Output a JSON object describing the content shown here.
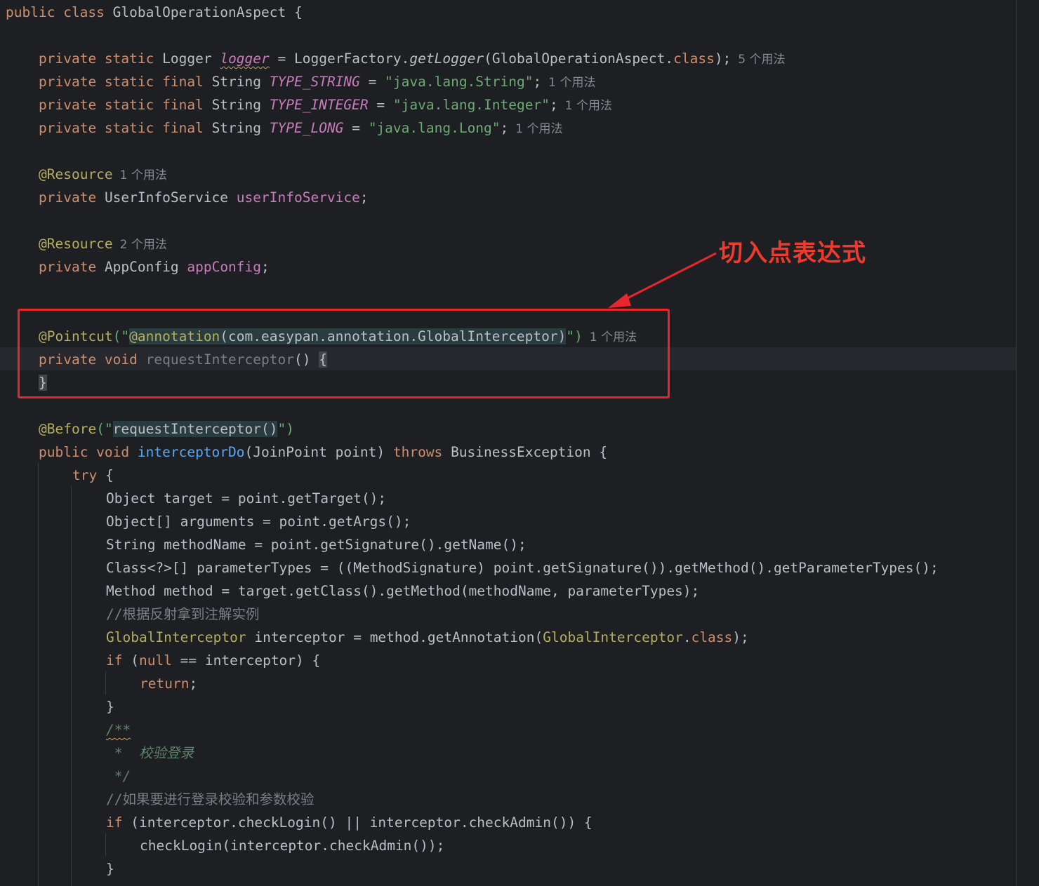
{
  "editor": {
    "class_decl": {
      "keyword1": "public",
      "keyword2": "class",
      "name": "GlobalOperationAspect",
      "brace": "{"
    },
    "logger_line": {
      "mods": "private static",
      "type": "Logger",
      "name": "logger",
      "eq": "=",
      "factory": "LoggerFactory.",
      "method": "getLogger",
      "arg": "(GlobalOperationAspect.",
      "cls": "class",
      "end": ");",
      "hint": "5 个用法"
    },
    "type_string_line": {
      "mods": "private static final",
      "type": "String",
      "name": "TYPE_STRING",
      "eq": "=",
      "value": "\"java.lang.String\"",
      "end": ";",
      "hint": "1 个用法"
    },
    "type_integer_line": {
      "mods": "private static final",
      "type": "String",
      "name": "TYPE_INTEGER",
      "eq": "=",
      "value": "\"java.lang.Integer\"",
      "end": ";",
      "hint": "1 个用法"
    },
    "type_long_line": {
      "mods": "private static final",
      "type": "String",
      "name": "TYPE_LONG",
      "eq": "=",
      "value": "\"java.lang.Long\"",
      "end": ";",
      "hint": "1 个用法"
    },
    "resource1": {
      "annotation": "@Resource",
      "hint": "1 个用法"
    },
    "user_service_line": {
      "mod": "private",
      "type": "UserInfoService",
      "name": "userInfoService",
      "end": ";"
    },
    "resource2": {
      "annotation": "@Resource",
      "hint": "2 个用法"
    },
    "app_config_line": {
      "mod": "private",
      "type": "AppConfig",
      "name": "appConfig",
      "end": ";"
    },
    "pointcut_line": {
      "annotation": "@Pointcut",
      "open": "(\"",
      "inner_ann": "@annotation",
      "inner_arg": "(com.easypan.annotation.GlobalInterceptor)",
      "close": "\")",
      "hint": "1 个用法"
    },
    "request_interceptor_line": {
      "mod": "private",
      "ret": "void",
      "name": "requestInterceptor",
      "parens": "()",
      "brace": "{"
    },
    "close_brace_1": "}",
    "before_line": {
      "annotation": "@Before",
      "open": "(\"",
      "arg": "requestInterceptor()",
      "close": "\")"
    },
    "interceptor_do_line": {
      "mods": "public void",
      "name": "interceptorDo",
      "params": "(JoinPoint point)",
      "throws": "throws",
      "exception": "BusinessException {"
    },
    "try_line": {
      "kw": "try",
      "rest": "{"
    },
    "target_line": "Object target = point.getTarget();",
    "arguments_line": "Object[] arguments = point.getArgs();",
    "method_name_line": "String methodName = point.getSignature().getName();",
    "param_types_line": "Class<?>[] parameterTypes = ((MethodSignature) point.getSignature()).getMethod().getParameterTypes();",
    "method_line": "Method method = target.getClass().getMethod(methodName, parameterTypes);",
    "comment1": "//根据反射拿到注解实例",
    "annotation_line": {
      "type": "GlobalInterceptor",
      "mid": " interceptor = method.getAnnotation(",
      "cls_type": "GlobalInterceptor",
      "dot": ".",
      "cls": "class",
      "end": ");"
    },
    "if_null_line": {
      "kw": "if",
      "open": " (",
      "null_kw": "null",
      "rest": " == interceptor) {"
    },
    "return_line": {
      "kw": "return",
      "end": ";"
    },
    "close_brace_2": "}",
    "doc_open": "/**",
    "doc_body": " *  校验登录",
    "doc_close": " */",
    "comment2": "//如果要进行登录校验和参数校验",
    "if_check_line": {
      "kw": "if",
      "rest": " (interceptor.checkLogin() || interceptor.checkAdmin()) {"
    },
    "check_login_line": "checkLogin(interceptor.checkAdmin());",
    "close_brace_3": "}"
  },
  "annotation_callout": {
    "label": "切入点表达式",
    "color": "#ee3b2e"
  }
}
